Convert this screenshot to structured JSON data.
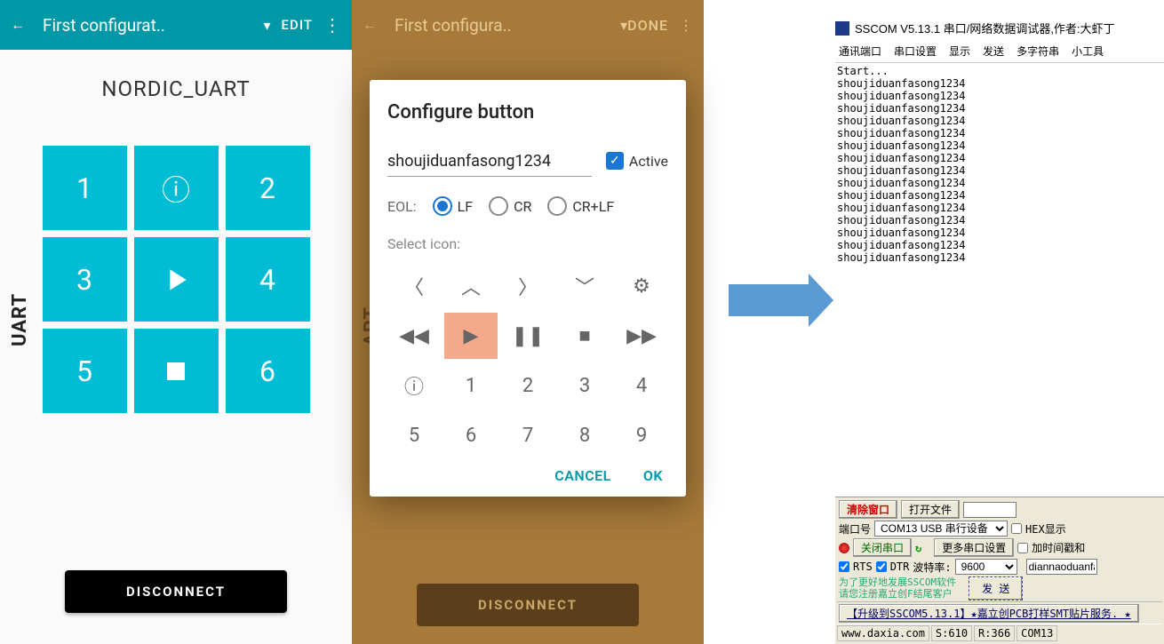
{
  "phone1": {
    "title": "First configurat..",
    "edit": "EDIT",
    "device": "NORDIC_UART",
    "side": "UART",
    "cells": [
      "1",
      "ⓘ",
      "2",
      "3",
      "▶",
      "4",
      "5",
      "■",
      "6"
    ],
    "disconnect": "DISCONNECT"
  },
  "phone2": {
    "title": "First configura..",
    "done": "DONE",
    "side": "ART",
    "disconnect": "DISCONNECT",
    "dialog": {
      "heading": "Configure button",
      "text_value": "shoujiduanfasong1234",
      "active_label": "Active",
      "eol_label": "EOL:",
      "eol_opts": [
        "LF",
        "CR",
        "CR+LF"
      ],
      "select_icon": "Select icon:",
      "icons_row3": [
        "ⓘ",
        "1",
        "2",
        "3",
        "4"
      ],
      "icons_row4": [
        "5",
        "6",
        "7",
        "8",
        "9"
      ],
      "cancel": "CANCEL",
      "ok": "OK"
    }
  },
  "sscom": {
    "title": "SSCOM V5.13.1 串口/网络数据调试器,作者:大虾丁",
    "menu": [
      "通讯端口",
      "串口设置",
      "显示",
      "发送",
      "多字符串",
      "小工具"
    ],
    "log": "Start...\nshoujiduanfasong1234\nshoujiduanfasong1234\nshoujiduanfasong1234\nshoujiduanfasong1234\nshoujiduanfasong1234\nshoujiduanfasong1234\nshoujiduanfasong1234\nshoujiduanfasong1234\nshoujiduanfasong1234\nshoujiduanfasong1234\nshoujiduanfasong1234\nshoujiduanfasong1234\nshoujiduanfasong1234\nshoujiduanfasong1234\nshoujiduanfasong1234",
    "btn_clear": "清除窗口",
    "btn_open": "打开文件",
    "port_label": "端口号",
    "port_value": "COM13 USB 串行设备",
    "hex_label": "HEX显示",
    "btn_close": "关闭串口",
    "more_settings": "更多串口设置",
    "timestamp_label": "加时间戳和",
    "rts": "RTS",
    "dtr": "DTR",
    "baud_label": "波特率:",
    "baud_value": "9600",
    "text_value": "diannaoduanfa",
    "tip1": "为了更好地发展SSCOM软件",
    "tip2": "请您注册嘉立创F结尾客户",
    "btn_send": "发 送",
    "upgrade": "【升级到SSCOM5.13.1】★嘉立创PCB打样SMT贴片服务. ★",
    "status_url": "www.daxia.com",
    "status_s": "S:610",
    "status_r": "R:366",
    "status_port": "COM13"
  }
}
